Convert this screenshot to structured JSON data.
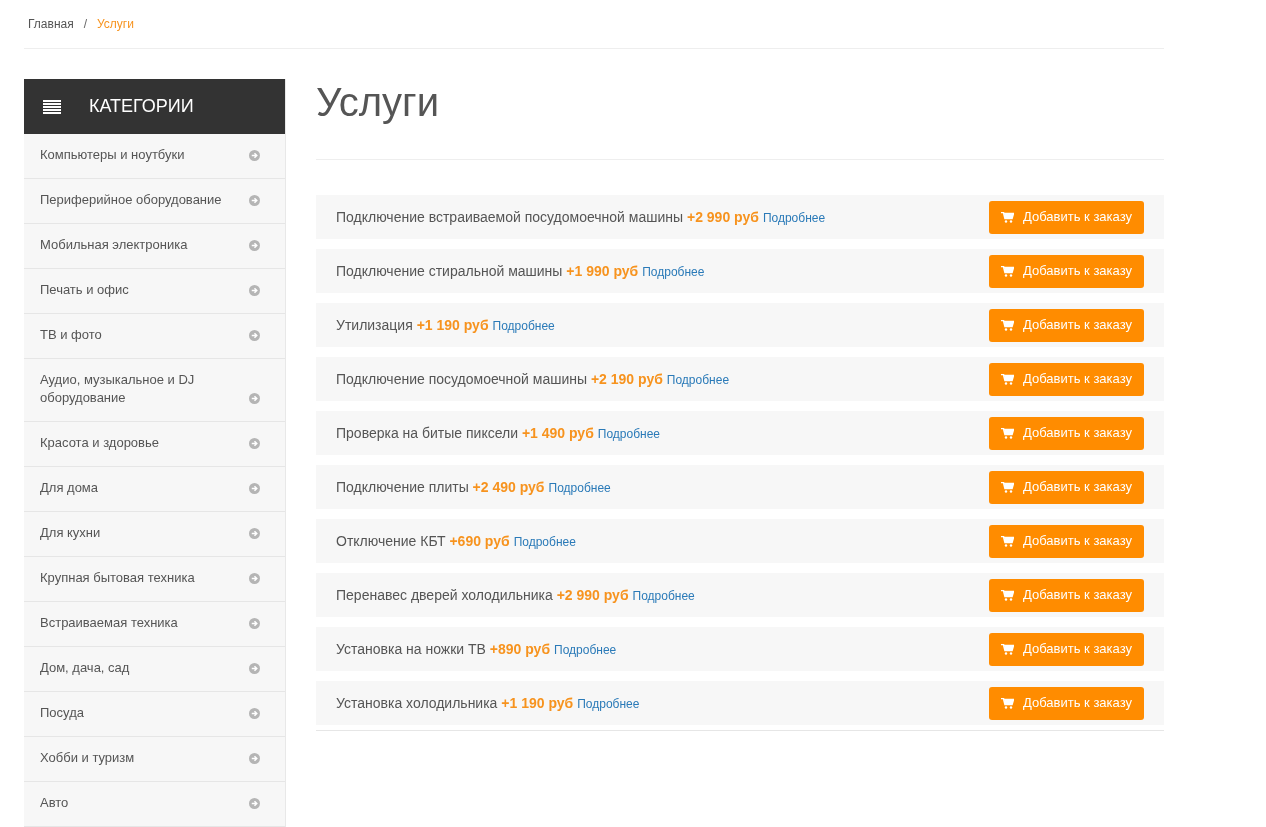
{
  "breadcrumb": [
    {
      "label": "Главная",
      "selected": false
    },
    {
      "label": "Услуги",
      "selected": true
    }
  ],
  "breadcrumb_separator": "/",
  "sidebar": {
    "title": "КАТЕГОРИИ",
    "items": [
      {
        "label": "Компьютеры и ноутбуки"
      },
      {
        "label": "Периферийное оборудование"
      },
      {
        "label": "Мобильная электроника"
      },
      {
        "label": "Печать и офис"
      },
      {
        "label": "ТВ и фото"
      },
      {
        "label": "Аудио, музыкальное и DJ оборудование"
      },
      {
        "label": "Красота и здоровье"
      },
      {
        "label": "Для дома"
      },
      {
        "label": "Для кухни"
      },
      {
        "label": "Крупная бытовая техника"
      },
      {
        "label": "Встраиваемая техника"
      },
      {
        "label": "Дом, дача, сад"
      },
      {
        "label": "Посуда"
      },
      {
        "label": "Хобби и туризм"
      },
      {
        "label": "Авто"
      }
    ]
  },
  "page_title": "Услуги",
  "services": [
    {
      "text": "Подключение встраиваемой посудомоечной машины **+2 990 руб**",
      "link": "Подробнее",
      "button": "Добавить к заказу"
    },
    {
      "text": "Подключение стиральной машины **+1 990 руб**",
      "link": "Подробнее",
      "button": "Добавить к заказу"
    },
    {
      "text": "Утилизация **+1 190 руб**",
      "link": "Подробнее",
      "button": "Добавить к заказу"
    },
    {
      "text": "Подключение посудомоечной машины **+2 190 руб**",
      "link": "Подробнее",
      "button": "Добавить к заказу"
    },
    {
      "text": "Проверка на битые пиксели **+1 490 руб**",
      "link": "Подробнее",
      "button": "Добавить к заказу"
    },
    {
      "text": "Подключение плиты **+2 490 руб**",
      "link": "Подробнее",
      "button": "Добавить к заказу"
    },
    {
      "text": "Отключение КБТ **+690 руб**",
      "link": "Подробнее",
      "button": "Добавить к заказу"
    },
    {
      "text": "Перенавес дверей холодильника **+2 990 руб**",
      "link": "Подробнее",
      "button": "Добавить к заказу"
    },
    {
      "text": "Установка на ножки ТВ **+890 руб**",
      "link": "Подробнее",
      "button": "Добавить к заказу"
    },
    {
      "text": "Установка холодильника **+1 190 руб**",
      "link": "Подробнее",
      "button": "Добавить к заказу"
    }
  ]
}
